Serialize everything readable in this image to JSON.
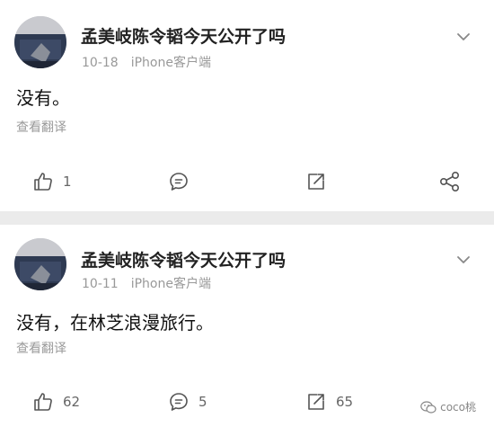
{
  "posts": [
    {
      "username": "孟美岐陈令韬今天公开了吗",
      "date": "10-18",
      "device": "iPhone客户端",
      "content": "没有。",
      "translate_label": "查看翻译",
      "likes": "1",
      "comments": "",
      "reposts": ""
    },
    {
      "username": "孟美岐陈令韬今天公开了吗",
      "date": "10-11",
      "device": "iPhone客户端",
      "content": "没有，在林芝浪漫旅行。",
      "translate_label": "查看翻译",
      "likes": "62",
      "comments": "5",
      "reposts": "65"
    }
  ],
  "watermark": "coco桃",
  "icons": {
    "avatar": "user-avatar-image",
    "dropdown": "chevron-down-icon",
    "like": "thumbs-up-icon",
    "comment": "comment-bubble-icon",
    "repost": "repost-arrow-icon",
    "share": "share-nodes-icon",
    "wechat": "wechat-icon"
  },
  "colors": {
    "background": "#ebebeb",
    "card": "#ffffff",
    "text": "#222222",
    "meta": "#999999",
    "icon": "#555555"
  }
}
